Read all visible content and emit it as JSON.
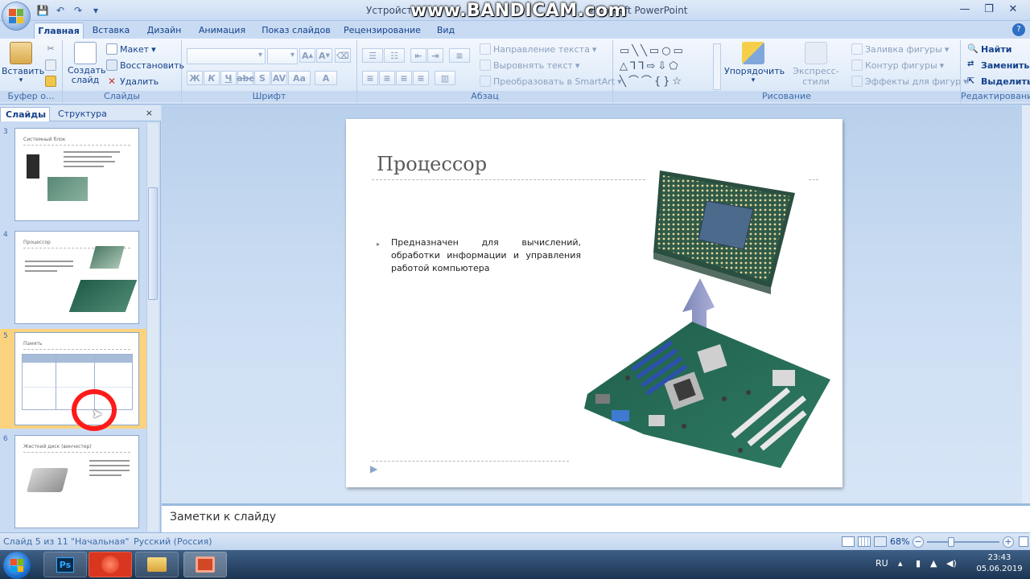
{
  "window": {
    "title_left": "Устройство",
    "watermark": "www.BANDICAM.com",
    "title_right": "Microsoft PowerPoint"
  },
  "quick_access": [
    "save-icon",
    "undo-icon",
    "redo-icon",
    "customize-icon"
  ],
  "tabs": [
    "Главная",
    "Вставка",
    "Дизайн",
    "Анимация",
    "Показ слайдов",
    "Рецензирование",
    "Вид"
  ],
  "ribbon": {
    "clipboard": {
      "paste": "Вставить",
      "label": "Буфер о..."
    },
    "slides": {
      "new_slide": "Создать слайд",
      "layout": "Макет",
      "reset": "Восстановить",
      "delete": "Удалить",
      "label": "Слайды"
    },
    "font": {
      "label": "Шрифт"
    },
    "paragraph": {
      "text_direction": "Направление текста",
      "align_text": "Выровнять текст",
      "smartart": "Преобразовать в SmartArt",
      "label": "Абзац"
    },
    "drawing": {
      "arrange": "Упорядочить",
      "quick_styles": "Экспресс-стили",
      "shape_fill": "Заливка фигуры",
      "shape_outline": "Контур фигуры",
      "shape_effects": "Эффекты для фигур",
      "label": "Рисование"
    },
    "editing": {
      "find": "Найти",
      "replace": "Заменить",
      "select": "Выделить",
      "label": "Редактирование"
    }
  },
  "slides_panel": {
    "tab_slides": "Слайды",
    "tab_outline": "Структура",
    "close": "×",
    "thumbnails": [
      {
        "num": "3",
        "title": "Системный блок"
      },
      {
        "num": "4",
        "title": "Процессор"
      },
      {
        "num": "5",
        "title": "Память"
      },
      {
        "num": "6",
        "title": "Жесткий диск (винчестер)"
      }
    ]
  },
  "slide": {
    "title": "Процессор",
    "bullet": "Предназначен для вычислений, обработки информации и управления работой компьютера"
  },
  "notes": {
    "placeholder": "Заметки к слайду"
  },
  "status": {
    "slide_info": "Слайд 5 из 11",
    "theme": "\"Начальная\"",
    "language": "Русский (Россия)",
    "zoom": "68%"
  },
  "taskbar": {
    "lang": "RU",
    "time": "23:43",
    "date": "05.06.2019",
    "apps": [
      "photoshop",
      "bandicam",
      "explorer",
      "powerpoint"
    ]
  },
  "colors": {
    "accent": "#15428b",
    "selected_thumb": "#fbd27d",
    "cursor_ring": "#ff1a1a"
  }
}
